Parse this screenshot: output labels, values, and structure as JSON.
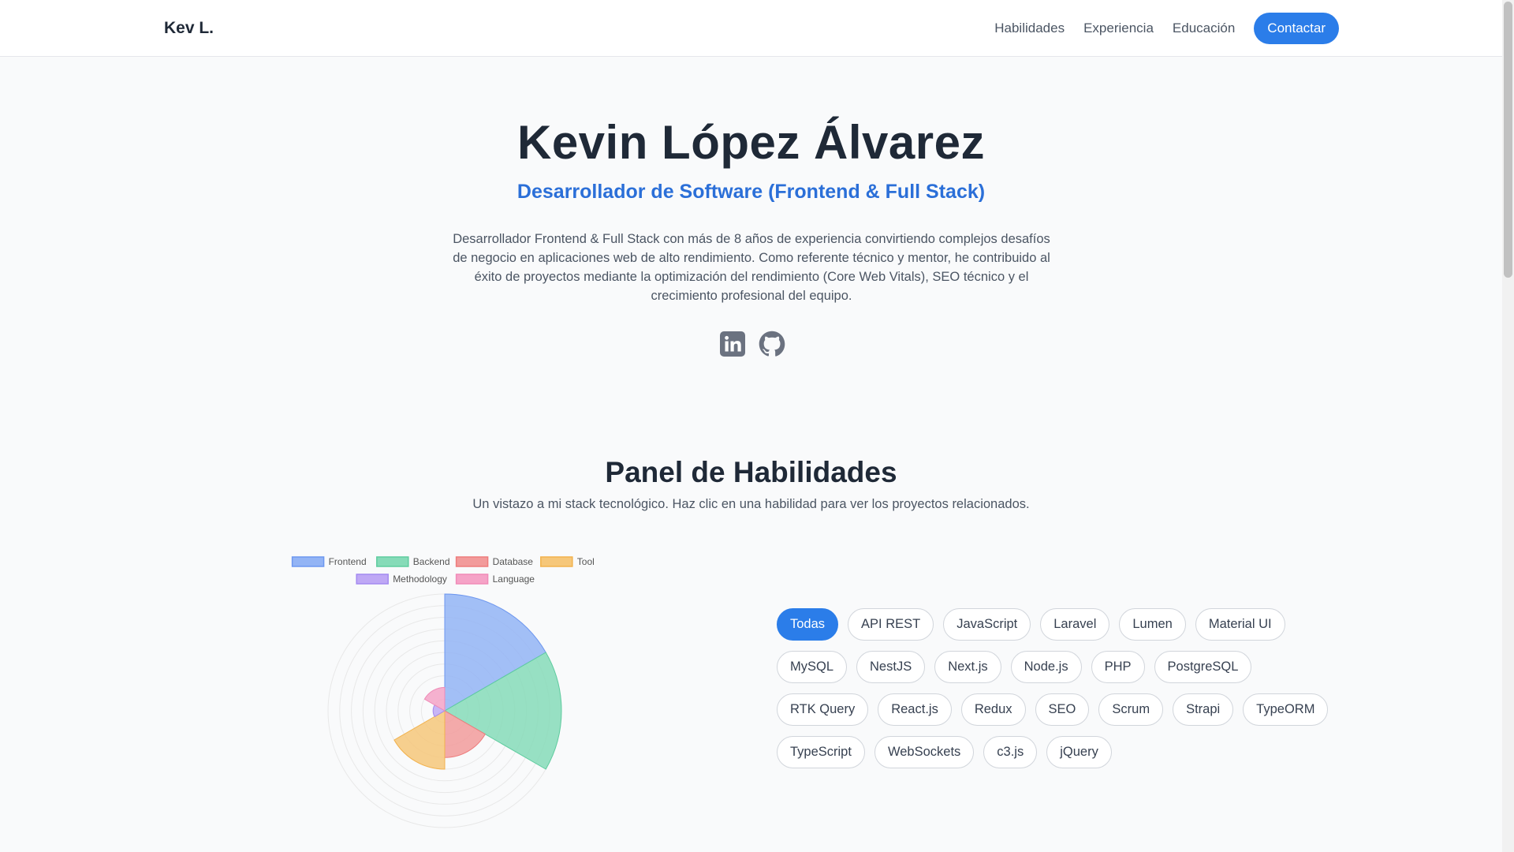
{
  "header": {
    "brand": "Kev L.",
    "nav": [
      {
        "label": "Habilidades"
      },
      {
        "label": "Experiencia"
      },
      {
        "label": "Educación"
      }
    ],
    "cta": "Contactar"
  },
  "hero": {
    "name": "Kevin López Álvarez",
    "role": "Desarrollador de Software (Frontend & Full Stack)",
    "description": "Desarrollador Frontend & Full Stack con más de 8 años de experiencia convirtiendo complejos desafíos de negocio en aplicaciones web de alto rendimiento. Como referente técnico y mentor, he contribuido al éxito de proyectos mediante la optimización del rendimiento (Core Web Vitals), SEO técnico y el crecimiento profesional del equipo.",
    "socials": [
      {
        "icon": "linkedin-icon"
      },
      {
        "icon": "github-icon"
      }
    ]
  },
  "skills": {
    "title": "Panel de Habilidades",
    "subtitle": "Un vistazo a mi stack tecnológico. Haz clic en una habilidad para ver los proyectos relacionados.",
    "tags": [
      {
        "label": "Todas",
        "active": true
      },
      {
        "label": "API REST"
      },
      {
        "label": "JavaScript"
      },
      {
        "label": "Laravel"
      },
      {
        "label": "Lumen"
      },
      {
        "label": "Material UI"
      },
      {
        "label": "MySQL"
      },
      {
        "label": "NestJS"
      },
      {
        "label": "Next.js"
      },
      {
        "label": "Node.js"
      },
      {
        "label": "PHP"
      },
      {
        "label": "PostgreSQL"
      },
      {
        "label": "RTK Query"
      },
      {
        "label": "React.js"
      },
      {
        "label": "Redux"
      },
      {
        "label": "SEO"
      },
      {
        "label": "Scrum"
      },
      {
        "label": "Strapi"
      },
      {
        "label": "TypeORM"
      },
      {
        "label": "TypeScript"
      },
      {
        "label": "WebSockets"
      },
      {
        "label": "c3.js"
      },
      {
        "label": "jQuery"
      }
    ]
  },
  "chart_data": {
    "type": "polarArea",
    "categories": [
      "Frontend",
      "Backend",
      "Database",
      "Tool",
      "Methodology",
      "Language"
    ],
    "values": [
      10,
      10,
      4,
      5,
      1,
      2
    ],
    "colors": [
      "#93b4f5",
      "#86dbb8",
      "#f29b9b",
      "#f6c77a",
      "#bfa8f5",
      "#f5a3c7"
    ],
    "borders": [
      "#6d97f0",
      "#5fcc9f",
      "#ee7c7c",
      "#f2b24d",
      "#a48af0",
      "#f08bb8"
    ],
    "rmax": 10,
    "grid": true,
    "legend": "top"
  },
  "colors": {
    "accent": "#2b7de9",
    "subtitle": "#2b6fd8"
  }
}
